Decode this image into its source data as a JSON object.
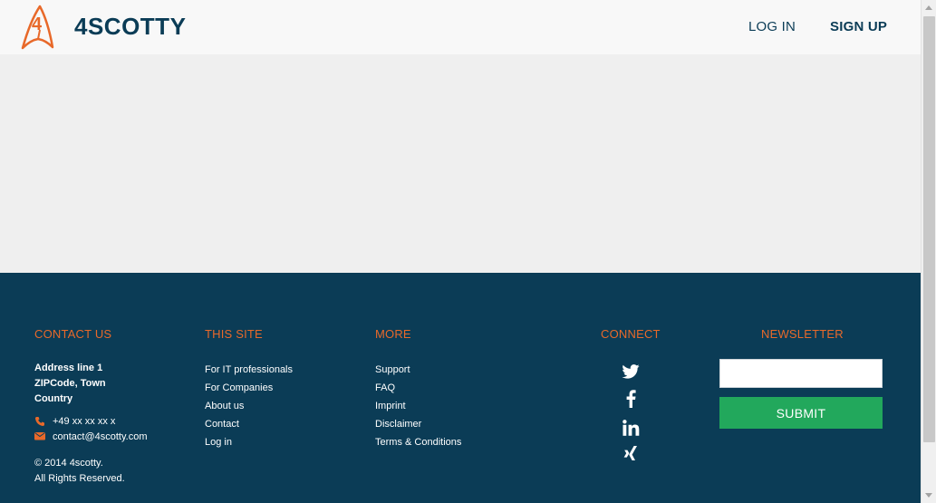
{
  "header": {
    "logo_text": "4SCOTTY",
    "login_label": "LOG IN",
    "signup_label": "SIGN UP"
  },
  "colors": {
    "accent_orange": "#e8692a",
    "navy": "#0b3c56",
    "green": "#22a85c"
  },
  "footer": {
    "contact": {
      "title": "CONTACT US",
      "address_line1": "Address line 1",
      "address_line2": "ZIPCode, Town",
      "address_line3": "Country",
      "phone": "+49 xx xx xx x",
      "email": "contact@4scotty.com",
      "copyright_line1": "© 2014 4scotty.",
      "copyright_line2": "All Rights Reserved."
    },
    "this_site": {
      "title": "THIS SITE",
      "items": [
        "For IT professionals",
        "For Companies",
        "About us",
        "Contact",
        "Log in"
      ]
    },
    "more": {
      "title": "MORE",
      "items": [
        "Support",
        "FAQ",
        "Imprint",
        "Disclaimer",
        "Terms & Conditions"
      ]
    },
    "connect": {
      "title": "CONNECT",
      "icons": [
        "twitter-icon",
        "facebook-icon",
        "linkedin-icon",
        "xing-icon"
      ]
    },
    "newsletter": {
      "title": "NEWSLETTER",
      "input_value": "",
      "submit_label": "SUBMIT"
    }
  }
}
